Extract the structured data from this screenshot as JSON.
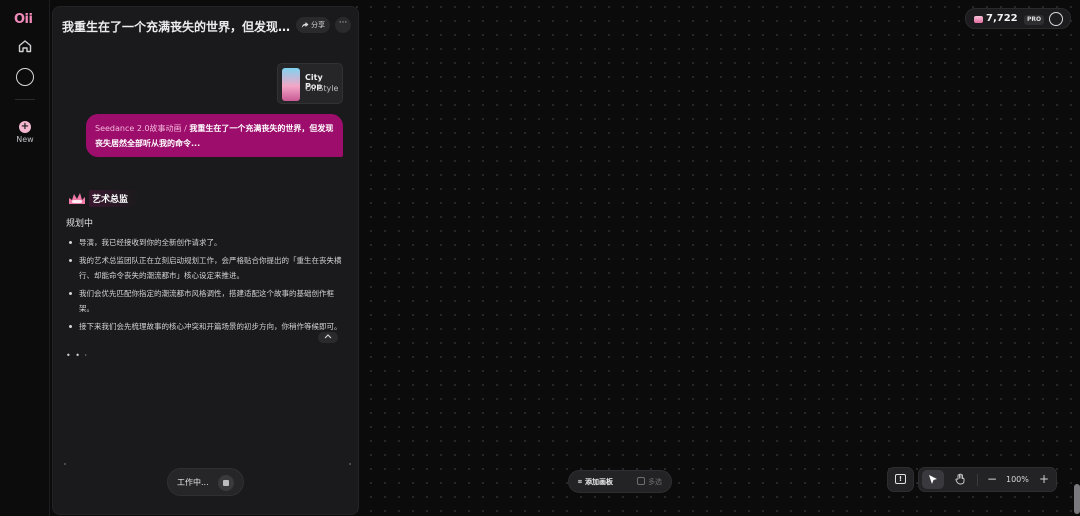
{
  "app": {
    "logo": "Oii"
  },
  "rail": {
    "new_label": "New"
  },
  "header": {
    "title": "我重生在了一个充满丧失的世界，但发现丧...",
    "share_label": "分享",
    "more_label": "···"
  },
  "style_card": {
    "name": "City Pop",
    "sub": "Oii Style"
  },
  "user_message": {
    "tag": "Seedance 2.0故事动画",
    "separator": "/",
    "text": "我重生在了一个充满丧失的世界，但发现丧失居然全部听从我的命令..."
  },
  "agent": {
    "name": "艺术总监",
    "status": "规划中",
    "bullets": [
      "导演，我已经接收到你的全新创作请求了。",
      "我的艺术总监团队正在立刻启动规划工作，会严格贴合你提出的「重生在丧失横行、却能命令丧失的潮流都市」核心设定来推进。",
      "我们会优先匹配你指定的潮流都市风格调性，搭建适配这个故事的基础创作框架。",
      "接下来我们会先梳理故事的核心冲突和开篇场景的初步方向，你稍作等候即可。"
    ],
    "typing": "• • ·"
  },
  "composer": {
    "working_label": "工作中..."
  },
  "credits": {
    "value": "7,722",
    "badge": "PRO"
  },
  "canvas_bar": {
    "add_canvas": "添加画板",
    "multi_select": "多选"
  },
  "zoom": {
    "value": "100%",
    "minus": "−",
    "plus": "+"
  },
  "colors": {
    "accent": "#9c0d6c",
    "brand_pink": "#f08ab8"
  }
}
